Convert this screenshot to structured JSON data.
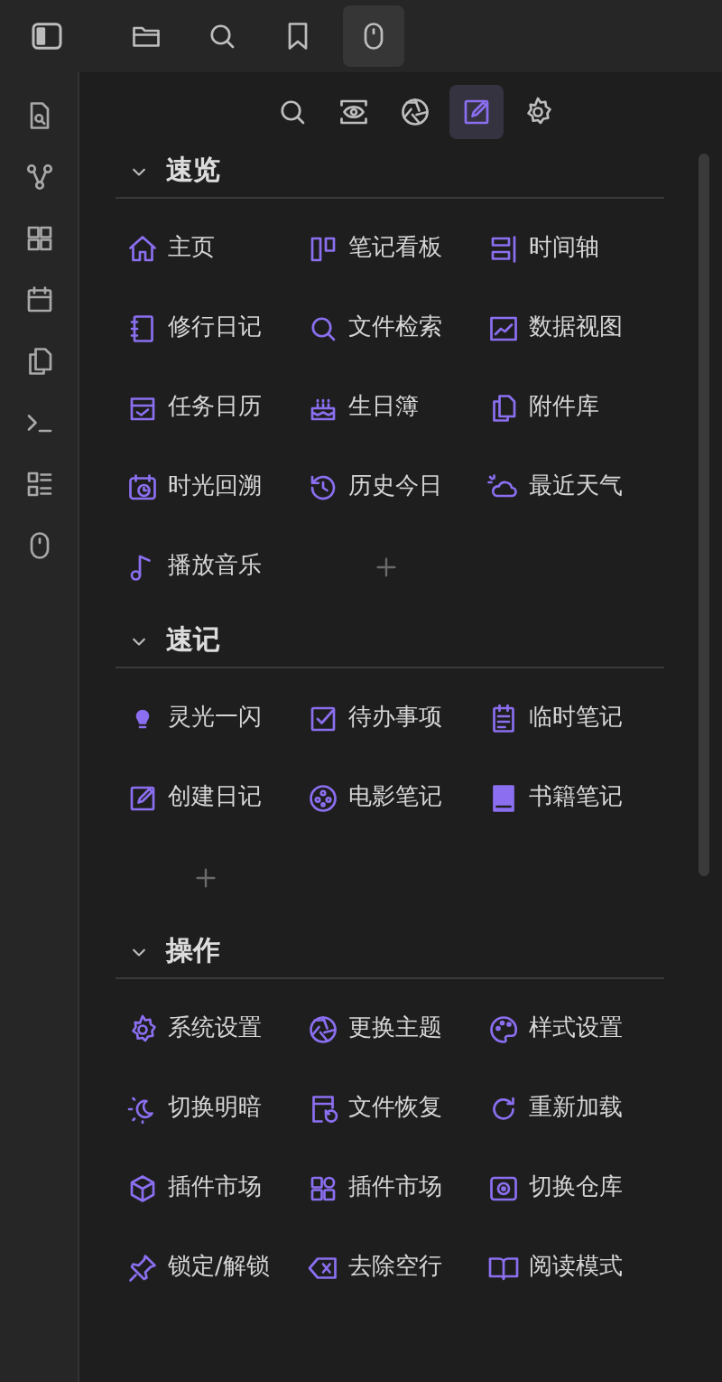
{
  "top_bar": {
    "tabs": [
      {
        "selected": false
      },
      {
        "selected": false
      },
      {
        "selected": false
      },
      {
        "selected": true
      }
    ]
  },
  "toolbar": {
    "buttons": [
      {
        "selected": false
      },
      {
        "selected": false
      },
      {
        "selected": false
      },
      {
        "selected": true
      },
      {
        "selected": false
      }
    ]
  },
  "sections": [
    {
      "title": "速览",
      "expanded": true,
      "items": [
        "主页",
        "笔记看板",
        "时间轴",
        "修行日记",
        "文件检索",
        "数据视图",
        "任务日历",
        "生日簿",
        "附件库",
        "时光回溯",
        "历史今日",
        "最近天气",
        "播放音乐"
      ],
      "add_button": true
    },
    {
      "title": "速记",
      "expanded": true,
      "items": [
        "灵光一闪",
        "待办事项",
        "临时笔记",
        "创建日记",
        "电影笔记",
        "书籍笔记"
      ],
      "add_button": true
    },
    {
      "title": "操作",
      "expanded": true,
      "items": [
        "系统设置",
        "更换主题",
        "样式设置",
        "切换明暗",
        "文件恢复",
        "重新加载",
        "插件市场",
        "插件市场",
        "切换仓库",
        "锁定/解锁",
        "去除空行",
        "阅读模式"
      ]
    }
  ]
}
